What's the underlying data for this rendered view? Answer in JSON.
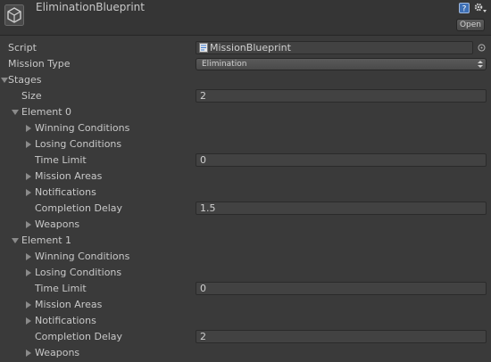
{
  "header": {
    "title": "EliminationBlueprint",
    "open_label": "Open"
  },
  "fields": {
    "script_label": "Script",
    "script_value": "MissionBlueprint",
    "mission_type_label": "Mission Type",
    "mission_type_value": "Elimination",
    "stages_label": "Stages",
    "size_label": "Size",
    "size_value": "2"
  },
  "elements": [
    {
      "label": "Element 0",
      "winning_label": "Winning Conditions",
      "losing_label": "Losing Conditions",
      "time_limit_label": "Time Limit",
      "time_limit_value": "0",
      "mission_areas_label": "Mission Areas",
      "notifications_label": "Notifications",
      "completion_delay_label": "Completion Delay",
      "completion_delay_value": "1.5",
      "weapons_label": "Weapons"
    },
    {
      "label": "Element 1",
      "winning_label": "Winning Conditions",
      "losing_label": "Losing Conditions",
      "time_limit_label": "Time Limit",
      "time_limit_value": "0",
      "mission_areas_label": "Mission Areas",
      "notifications_label": "Notifications",
      "completion_delay_label": "Completion Delay",
      "completion_delay_value": "2",
      "weapons_label": "Weapons"
    }
  ],
  "icons": {
    "asset": "unity-asset-icon",
    "help": "help-icon",
    "settings": "gear-icon",
    "script": "script-icon",
    "object_picker": "object-picker-icon"
  },
  "colors": {
    "background": "#3a3a3a",
    "header_background": "#353535",
    "field_background": "#424242",
    "text": "#c8c8c8"
  }
}
